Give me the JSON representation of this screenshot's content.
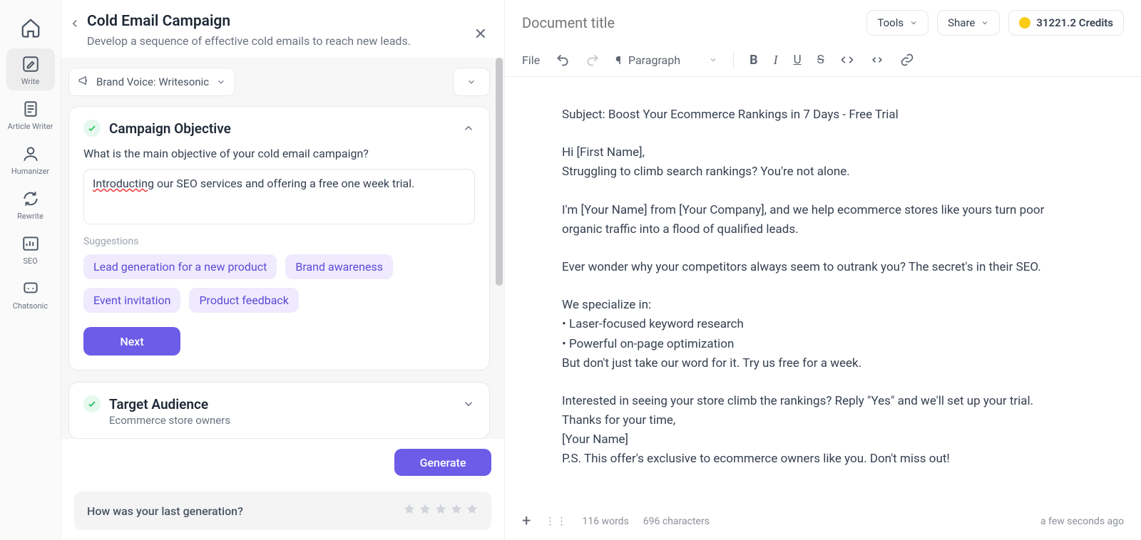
{
  "rail": {
    "items": [
      {
        "name": "write",
        "label": "Write"
      },
      {
        "name": "article-writer",
        "label": "Article Writer"
      },
      {
        "name": "humanizer",
        "label": "Humanizer"
      },
      {
        "name": "rewrite",
        "label": "Rewrite"
      },
      {
        "name": "seo",
        "label": "SEO"
      },
      {
        "name": "chatsonic",
        "label": "Chatsonic"
      }
    ]
  },
  "panel": {
    "title": "Cold Email Campaign",
    "subtitle": "Develop a sequence of effective cold emails to reach new leads.",
    "brand_voice_label": "Brand Voice: Writesonic",
    "objective": {
      "title": "Campaign Objective",
      "question": "What is the main objective of your cold email campaign?",
      "value": "Introducting our SEO services and offering a free one week trial.",
      "suggestions_label": "Suggestions",
      "suggestions": [
        "Lead generation for a new product",
        "Brand awareness",
        "Event invitation",
        "Product feedback"
      ],
      "next_label": "Next"
    },
    "audience": {
      "title": "Target Audience",
      "summary": "Ecommerce store owners"
    },
    "generate_label": "Generate",
    "feedback_prompt": "How was your last generation?"
  },
  "editor": {
    "doc_title_placeholder": "Document title",
    "tools_label": "Tools",
    "share_label": "Share",
    "credits_label": "31221.2 Credits",
    "toolbar": {
      "file": "File",
      "paragraph": "Paragraph"
    },
    "body": {
      "subject": "Subject: Boost Your Ecommerce Rankings in 7 Days - Free Trial",
      "p1a": "Hi [First Name],",
      "p1b": "Struggling to climb search rankings? You're not alone.",
      "p2": "I'm [Your Name] from [Your Company], and we help ecommerce stores like yours turn poor organic traffic into a flood of qualified leads.",
      "p3": "Ever wonder why your competitors always seem to outrank you? The secret's in their SEO.",
      "p4a": "We specialize in:",
      "p4b": "• Laser-focused keyword research",
      "p4c": "• Powerful on-page optimization",
      "p4d": "But don't just take our word for it. Try us free for a week.",
      "p5a": "Interested in seeing your store climb the rankings? Reply \"Yes\" and we'll set up your trial.",
      "p5b": "Thanks for your time,",
      "p5c": "[Your Name]",
      "p5d": "P.S. This offer's exclusive to ecommerce owners like you. Don't miss out!"
    },
    "footer": {
      "words": "116 words",
      "chars": "696 characters",
      "timeago": "a few seconds ago"
    }
  }
}
